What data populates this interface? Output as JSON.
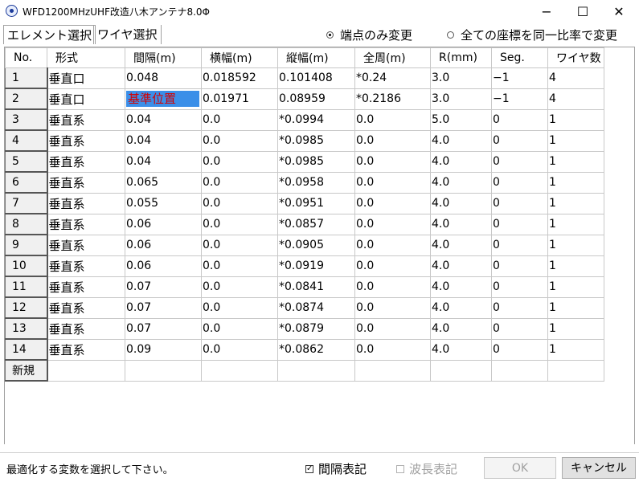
{
  "window": {
    "title": "WFD1200MHzUHF改造八木アンテナ8.0Φ",
    "minimize": "−",
    "maximize": "☐",
    "close": "✕"
  },
  "tabs": [
    {
      "label": "エレメント選択",
      "selected": true
    },
    {
      "label": "ワイヤ選択",
      "selected": false
    }
  ],
  "radios": [
    {
      "label": "端点のみ変更",
      "checked": true
    },
    {
      "label": "全ての座標を同一比率で変更",
      "checked": false
    }
  ],
  "grid": {
    "headers": [
      "No.",
      "形式",
      "間隔(m)",
      "横幅(m)",
      "縦幅(m)",
      "全周(m)",
      "R(mm)",
      "Seg.",
      "ワイヤ数"
    ],
    "rows": [
      [
        "1",
        "垂直口",
        "0.048",
        "0.018592",
        "0.101408",
        "*0.24",
        "3.0",
        "−1",
        "4"
      ],
      [
        "2",
        "垂直口",
        "基準位置",
        "0.01971",
        "0.08959",
        "*0.2186",
        "3.0",
        "−1",
        "4"
      ],
      [
        "3",
        "垂直系",
        "0.04",
        "0.0",
        "*0.0994",
        "0.0",
        "5.0",
        "0",
        "1"
      ],
      [
        "4",
        "垂直系",
        "0.04",
        "0.0",
        "*0.0985",
        "0.0",
        "4.0",
        "0",
        "1"
      ],
      [
        "5",
        "垂直系",
        "0.04",
        "0.0",
        "*0.0985",
        "0.0",
        "4.0",
        "0",
        "1"
      ],
      [
        "6",
        "垂直系",
        "0.065",
        "0.0",
        "*0.0958",
        "0.0",
        "4.0",
        "0",
        "1"
      ],
      [
        "7",
        "垂直系",
        "0.055",
        "0.0",
        "*0.0951",
        "0.0",
        "4.0",
        "0",
        "1"
      ],
      [
        "8",
        "垂直系",
        "0.06",
        "0.0",
        "*0.0857",
        "0.0",
        "4.0",
        "0",
        "1"
      ],
      [
        "9",
        "垂直系",
        "0.06",
        "0.0",
        "*0.0905",
        "0.0",
        "4.0",
        "0",
        "1"
      ],
      [
        "10",
        "垂直系",
        "0.06",
        "0.0",
        "*0.0919",
        "0.0",
        "4.0",
        "0",
        "1"
      ],
      [
        "11",
        "垂直系",
        "0.07",
        "0.0",
        "*0.0841",
        "0.0",
        "4.0",
        "0",
        "1"
      ],
      [
        "12",
        "垂直系",
        "0.07",
        "0.0",
        "*0.0874",
        "0.0",
        "4.0",
        "0",
        "1"
      ],
      [
        "13",
        "垂直系",
        "0.07",
        "0.0",
        "*0.0879",
        "0.0",
        "4.0",
        "0",
        "1"
      ],
      [
        "14",
        "垂直系",
        "0.09",
        "0.0",
        "*0.0862",
        "0.0",
        "4.0",
        "0",
        "1"
      ]
    ],
    "new_row_label": "新規",
    "selected_cell": {
      "row": 2,
      "column": "間隔(m)"
    },
    "selected_cell_bg": "#3b8fe8",
    "selected_cell_text_color": "#d40000"
  },
  "status": {
    "message": "最適化する変数を選択して下さい。"
  },
  "options": {
    "spacing_label": "間隔表記",
    "spacing_checked": true,
    "wavelength_label": "波長表記",
    "wavelength_checked": false,
    "wavelength_enabled": false
  },
  "buttons": {
    "ok": "OK",
    "ok_enabled": false,
    "cancel": "キャンセル"
  },
  "icons": {
    "app": "antenna-app-icon",
    "check": "checkmark-icon"
  }
}
